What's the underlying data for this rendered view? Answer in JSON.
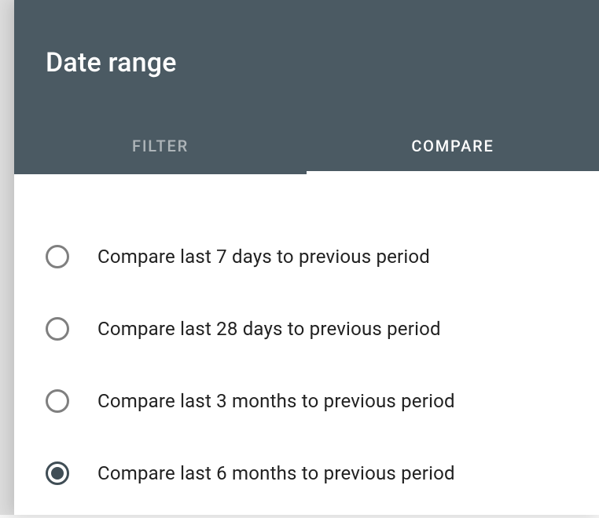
{
  "header": {
    "title": "Date range"
  },
  "tabs": {
    "filter": {
      "label": "FILTER",
      "active": false
    },
    "compare": {
      "label": "COMPARE",
      "active": true
    }
  },
  "options": [
    {
      "label": "Compare last 7 days to previous period",
      "selected": false
    },
    {
      "label": "Compare last 28 days to previous period",
      "selected": false
    },
    {
      "label": "Compare last 3 months to previous period",
      "selected": false
    },
    {
      "label": "Compare last 6 months to previous period",
      "selected": true
    }
  ]
}
